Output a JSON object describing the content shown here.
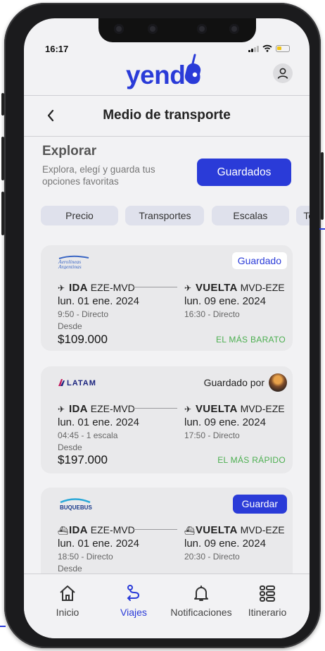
{
  "status_bar": {
    "time": "16:17"
  },
  "app": {
    "logo": "yendo"
  },
  "header": {
    "title": "Medio de transporte",
    "back_icon": "chevron-left-icon",
    "profile_icon": "user-icon"
  },
  "explore": {
    "title": "Explorar",
    "subtitle": "Explora, elegí y guarda tus opciones favoritas",
    "saved_button": "Guardados"
  },
  "filters": [
    "Precio",
    "Transportes",
    "Escalas",
    "To"
  ],
  "results": [
    {
      "carrier": "Aerolíneas Argentinas",
      "logo_line1": "Aerolíneas",
      "logo_line2": "Argentinas",
      "tag": "Guardado",
      "ida": {
        "label": "IDA",
        "route": "EZE-MVD",
        "date": "lun. 01 ene. 2024",
        "meta": "9:50 - Directo"
      },
      "vuelta": {
        "label": "VUELTA",
        "route": "MVD-EZE",
        "date": "lun. 09 ene. 2024",
        "meta": "16:30 - Directo"
      },
      "desde": "Desde",
      "price": "$109.000",
      "highlight": "EL MÁS BARATO"
    },
    {
      "carrier": "LATAM",
      "tag": "Guardado por",
      "ida": {
        "label": "IDA",
        "route": "EZE-MVD",
        "date": "lun. 01 ene. 2024",
        "meta": "04:45 - 1 escala"
      },
      "vuelta": {
        "label": "VUELTA",
        "route": "MVD-EZE",
        "date": "lun. 09 ene. 2024",
        "meta": "17:50 - Directo"
      },
      "desde": "Desde",
      "price": "$197.000",
      "highlight": "EL MÁS RÁPIDO"
    },
    {
      "carrier": "BUQUEBUS",
      "tag": "Guardar",
      "ida": {
        "label": "IDA",
        "route": "EZE-MVD",
        "date": "lun. 01 ene. 2024",
        "meta": "18:50 - Directo"
      },
      "vuelta": {
        "label": "VUELTA",
        "route": "MVD-EZE",
        "date": "lun. 09 ene. 2024",
        "meta": "20:30 - Directo"
      },
      "desde": "Desde"
    }
  ],
  "bottom_nav": [
    {
      "label": "Inicio",
      "icon": "home-icon",
      "active": false
    },
    {
      "label": "Viajes",
      "icon": "route-icon",
      "active": true
    },
    {
      "label": "Notificaciones",
      "icon": "bell-icon",
      "active": false
    },
    {
      "label": "Itinerario",
      "icon": "list-icon",
      "active": false
    }
  ],
  "colors": {
    "accent": "#2a3bd8",
    "highlight": "#4caf50",
    "background": "#f2f2f4",
    "card": "#e9e9eb"
  }
}
